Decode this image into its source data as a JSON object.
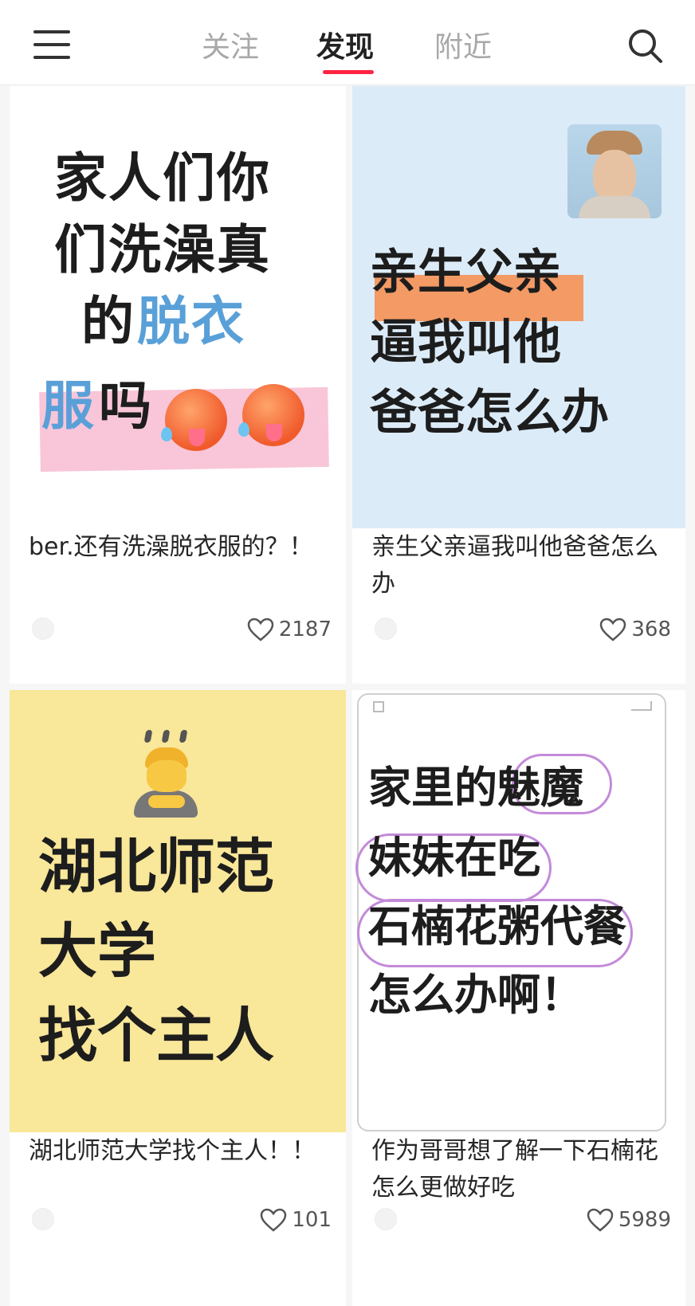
{
  "nav": {
    "tabs": [
      {
        "label": "关注",
        "active": false
      },
      {
        "label": "发现",
        "active": true
      },
      {
        "label": "附近",
        "active": false
      }
    ],
    "icons": {
      "menu": "hamburger-menu-icon",
      "search": "search-icon"
    },
    "accent_color": "#ff2442"
  },
  "feed": {
    "cards": [
      {
        "cover_lines": [
          "家人们你",
          "们洗澡真",
          "的",
          "脱衣",
          "服",
          "吗"
        ],
        "cover_bg": "#ffffff",
        "title": "ber.还有洗澡脱衣服的？！",
        "likes": "2187"
      },
      {
        "cover_lines": [
          "亲生父亲",
          "逼我叫他",
          "爸爸怎么办"
        ],
        "cover_bg": "#dcebf8",
        "title": "亲生父亲逼我叫他爸爸怎么办",
        "likes": "368"
      },
      {
        "cover_lines": [
          "湖北师范",
          "大学",
          "找个主人"
        ],
        "cover_bg": "#f9e79a",
        "title": "湖北师范大学找个主人！！",
        "likes": "101"
      },
      {
        "cover_lines": [
          "家里的魅魔",
          "妹妹在吃",
          "石楠花粥代餐",
          "怎么办啊！"
        ],
        "cover_bg": "#ffffff",
        "title": "作为哥哥想了解一下石楠花怎么更做好吃",
        "likes": "5989"
      }
    ]
  }
}
